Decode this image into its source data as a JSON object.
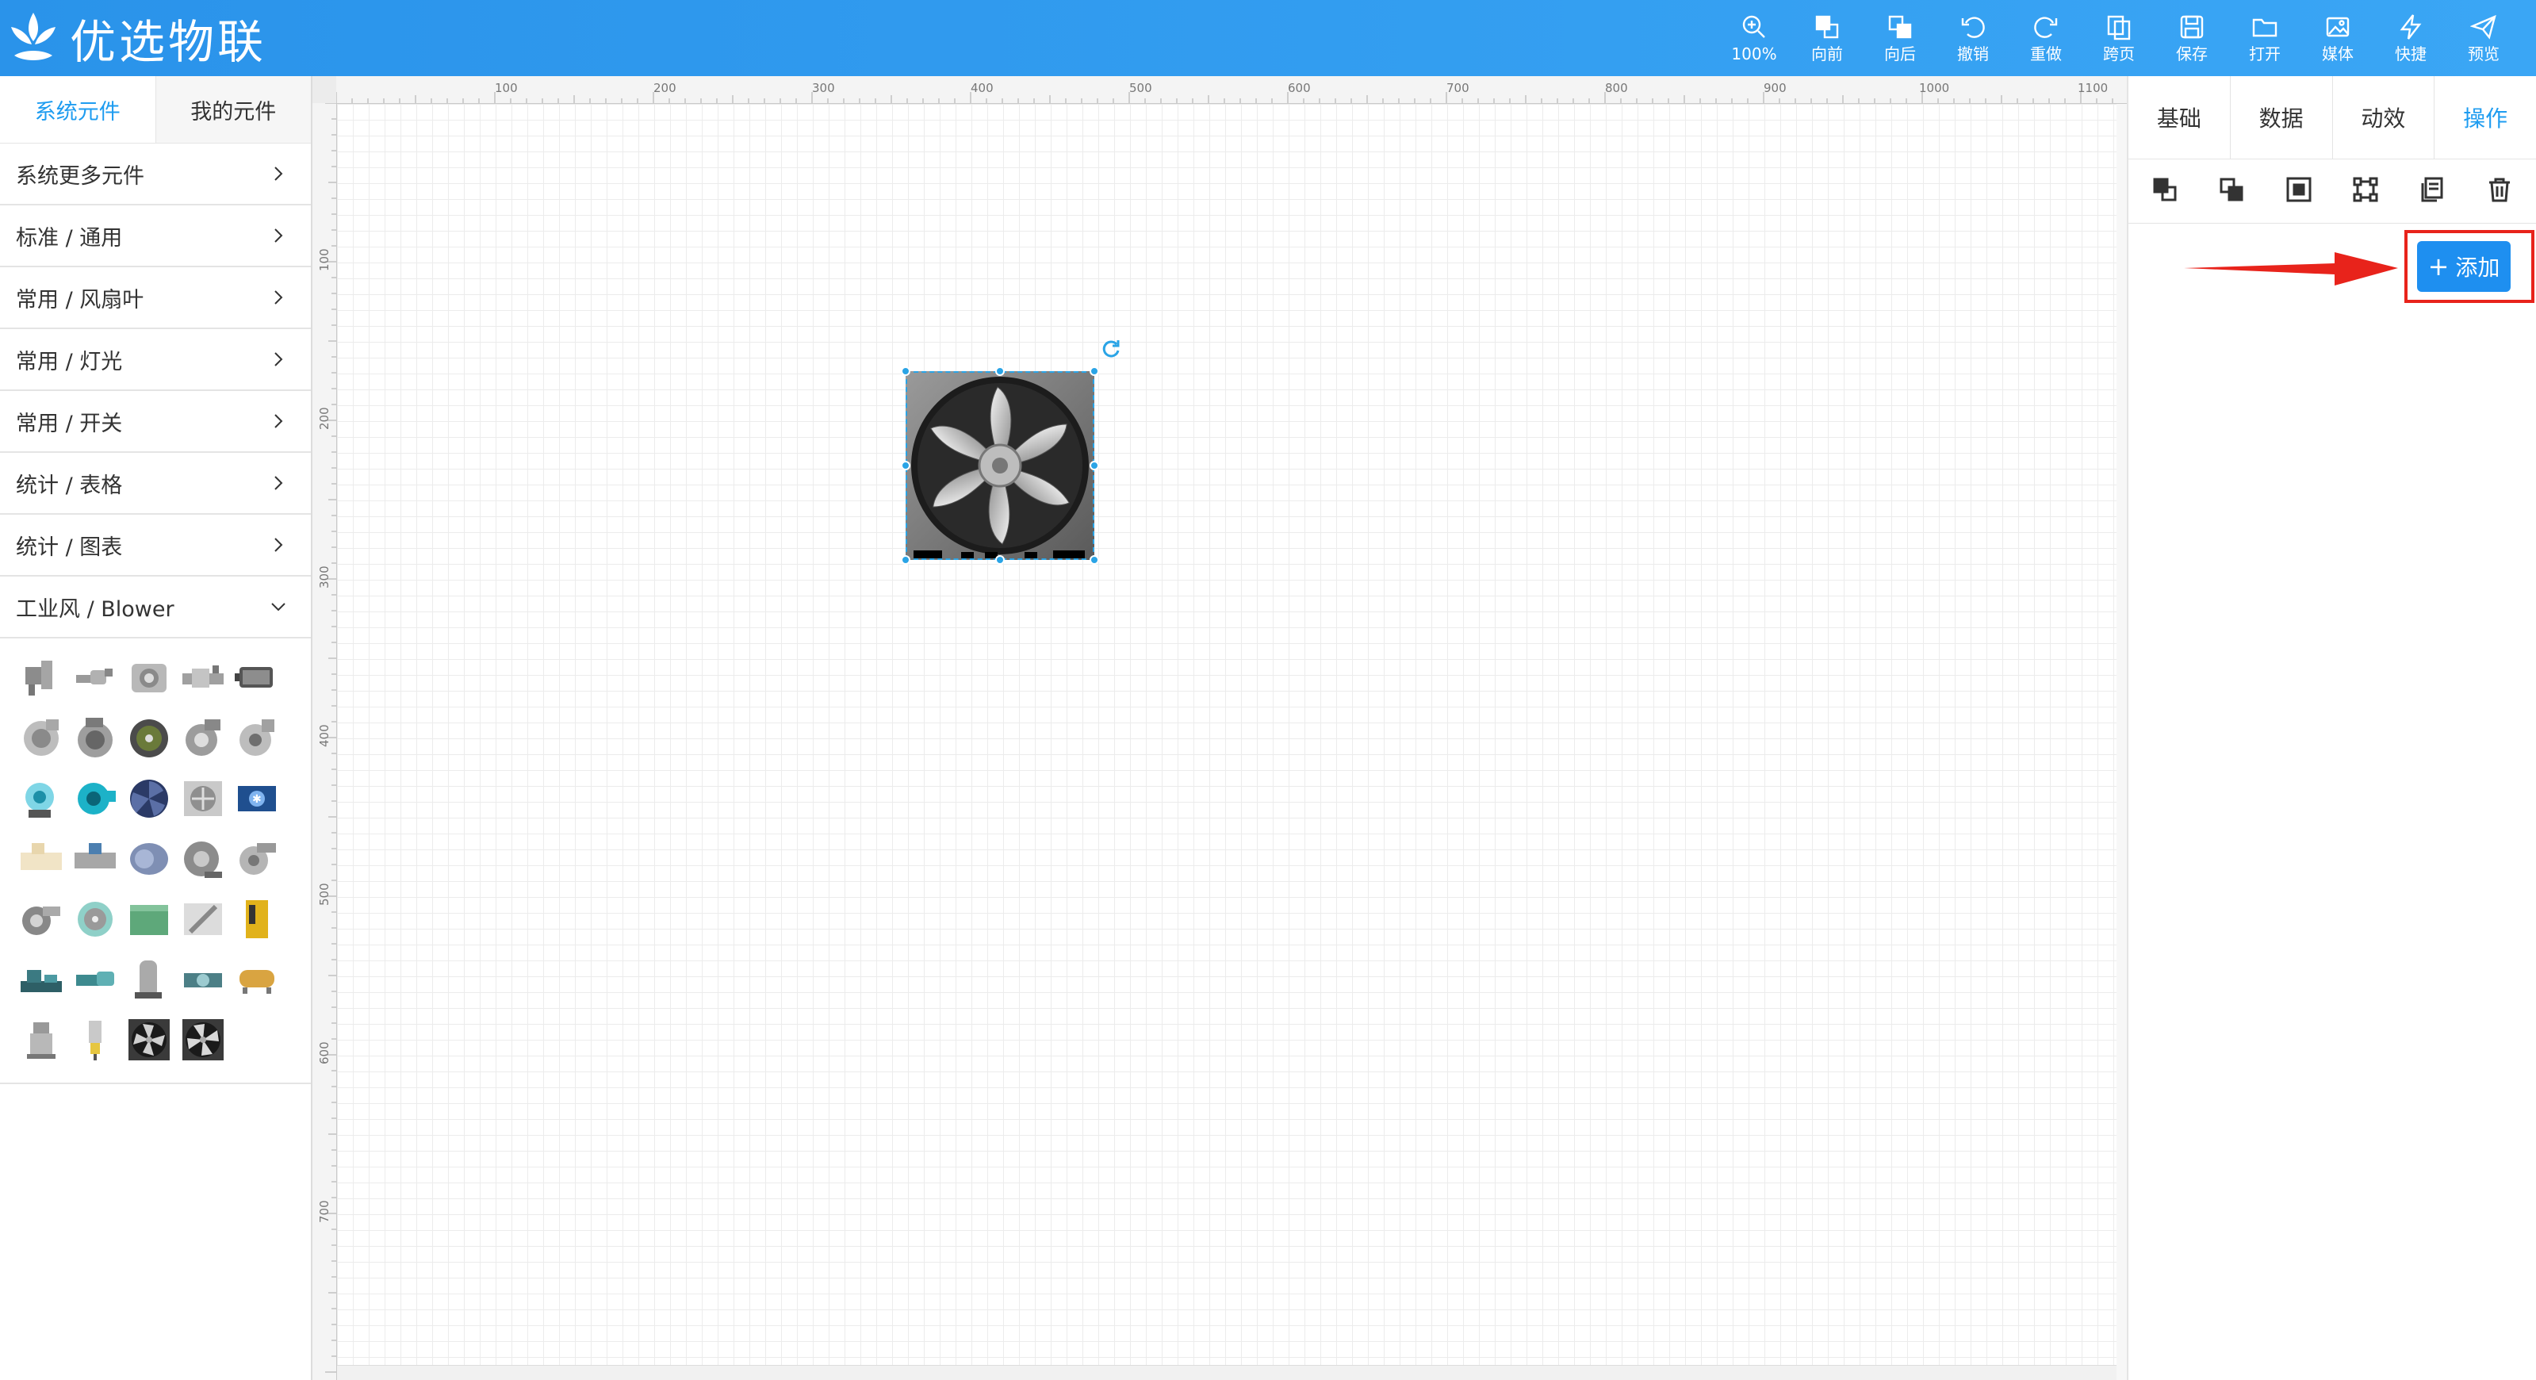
{
  "app": {
    "title": "优选物联"
  },
  "toolbar": [
    {
      "label": "100%",
      "icon": "zoom-icon"
    },
    {
      "label": "向前",
      "icon": "bring-forward-icon"
    },
    {
      "label": "向后",
      "icon": "send-backward-icon"
    },
    {
      "label": "撤销",
      "icon": "undo-icon"
    },
    {
      "label": "重做",
      "icon": "redo-icon"
    },
    {
      "label": "跨页",
      "icon": "cross-page-icon"
    },
    {
      "label": "保存",
      "icon": "save-icon"
    },
    {
      "label": "打开",
      "icon": "open-folder-icon"
    },
    {
      "label": "媒体",
      "icon": "media-icon"
    },
    {
      "label": "快捷",
      "icon": "lightning-icon"
    },
    {
      "label": "预览",
      "icon": "send-preview-icon"
    }
  ],
  "left": {
    "tabs": [
      "系统元件",
      "我的元件"
    ],
    "categories": [
      "系统更多元件",
      "标准 / 通用",
      "常用 / 风扇叶",
      "常用 / 灯光",
      "常用 / 开关",
      "统计 / 表格",
      "统计 / 图表",
      "工业风 / Blower"
    ]
  },
  "ruler": {
    "top": [
      "100",
      "200",
      "300",
      "400",
      "500",
      "600",
      "700",
      "800",
      "900",
      "1000",
      "1100"
    ],
    "left": [
      "100",
      "200",
      "300",
      "400",
      "500",
      "600",
      "700"
    ]
  },
  "right": {
    "tabs": [
      "基础",
      "数据",
      "动效",
      "操作"
    ],
    "add_label": "添加",
    "add_plus": "+"
  },
  "colors": {
    "brand": "#2a93ea",
    "accent": "#1e9cf0",
    "highlight": "#e8231b"
  }
}
